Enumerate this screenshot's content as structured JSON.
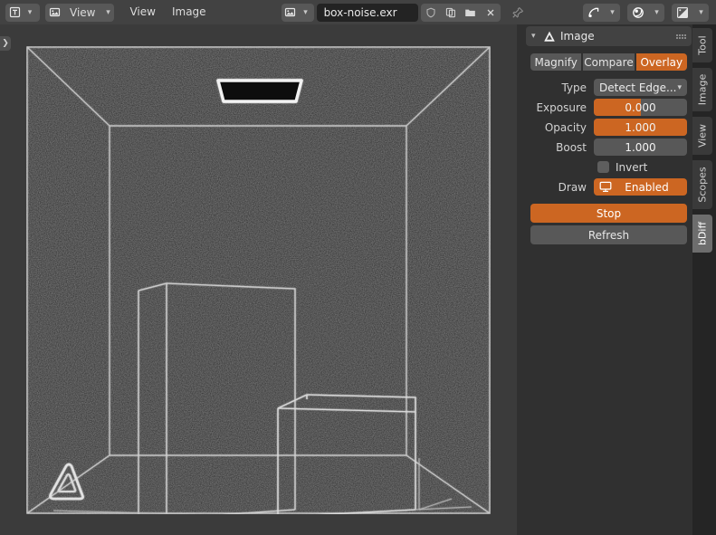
{
  "app": {
    "name": "Blender Image Editor",
    "accent": "#cc6622",
    "bg": "#303030",
    "header_bg": "#424242",
    "canvas_bg": "#3b3b3b"
  },
  "header": {
    "editor_type": {
      "icon": "uv-image-editor-icon",
      "chevron": "chevron-down-icon"
    },
    "mode_selector": {
      "icon": "image-icon",
      "label": "View",
      "chevron": "chevron-down-icon"
    },
    "menus": [
      {
        "label": "View"
      },
      {
        "label": "Image"
      }
    ],
    "datablock": {
      "browse_icon": "image-datablock-icon",
      "browse_chevron": "chevron-down-icon",
      "name": "box-noise.exr",
      "buttons": [
        {
          "name": "fake-user-button",
          "icon": "shield-icon"
        },
        {
          "name": "new-image-button",
          "icon": "copy-icon"
        },
        {
          "name": "open-image-button",
          "icon": "folder-icon"
        },
        {
          "name": "unlink-image-button",
          "icon": "close-x-icon"
        }
      ],
      "pin": {
        "name": "pin-button",
        "icon": "pin-icon"
      }
    },
    "right_toggles": [
      {
        "name": "display-channels-toggle",
        "icon": "render-pass-icon",
        "active": true,
        "chevron": "chevron-down-icon"
      },
      {
        "name": "image-slot-toggle",
        "icon": "color-management-icon",
        "active": true,
        "chevron": "chevron-down-icon"
      },
      {
        "name": "overlay-toggle",
        "icon": "overlays-icon",
        "active": false,
        "chevron": "chevron-down-icon"
      }
    ]
  },
  "canvas": {
    "toggle_arrow": "chevron-right-icon",
    "image_name": "box-noise.exr",
    "description": "Edge-detected noisy render of a cornell-box style interior with a ceiling light panel, a tall rectangular block on the left, a cube on the right, and a rounded triangle logo object at the lower left."
  },
  "sidebar": {
    "panel": {
      "title": "Image",
      "collapse_icon": "chevron-down-icon",
      "panel_icon": "triangle-logo-icon",
      "grip": "drag-grip-icon"
    },
    "tabs": [
      {
        "label": "Magnify",
        "active": false
      },
      {
        "label": "Compare",
        "active": false
      },
      {
        "label": "Overlay",
        "active": true
      }
    ],
    "fields": [
      {
        "kind": "dropdown",
        "label": "Type",
        "value": "Detect Edge...",
        "chevron": "chevron-down-icon"
      },
      {
        "kind": "slider",
        "label": "Exposure",
        "value": "0.000",
        "fill_percent": 50
      },
      {
        "kind": "slider",
        "label": "Opacity",
        "value": "1.000",
        "fill_percent": 100
      },
      {
        "kind": "slider",
        "label": "Boost",
        "value": "1.000",
        "fill_percent": 0
      }
    ],
    "invert": {
      "label": "Invert",
      "checked": false
    },
    "draw": {
      "label": "Draw",
      "value": "Enabled",
      "icon": "monitor-icon",
      "enabled": true
    },
    "buttons": [
      {
        "label": "Stop",
        "style": "primary"
      },
      {
        "label": "Refresh",
        "style": "secondary"
      }
    ]
  },
  "vertical_tabs": [
    {
      "label": "Tool",
      "active": false
    },
    {
      "label": "Image",
      "active": false
    },
    {
      "label": "View",
      "active": false
    },
    {
      "label": "Scopes",
      "active": false
    },
    {
      "label": "bDiff",
      "active": true
    }
  ]
}
